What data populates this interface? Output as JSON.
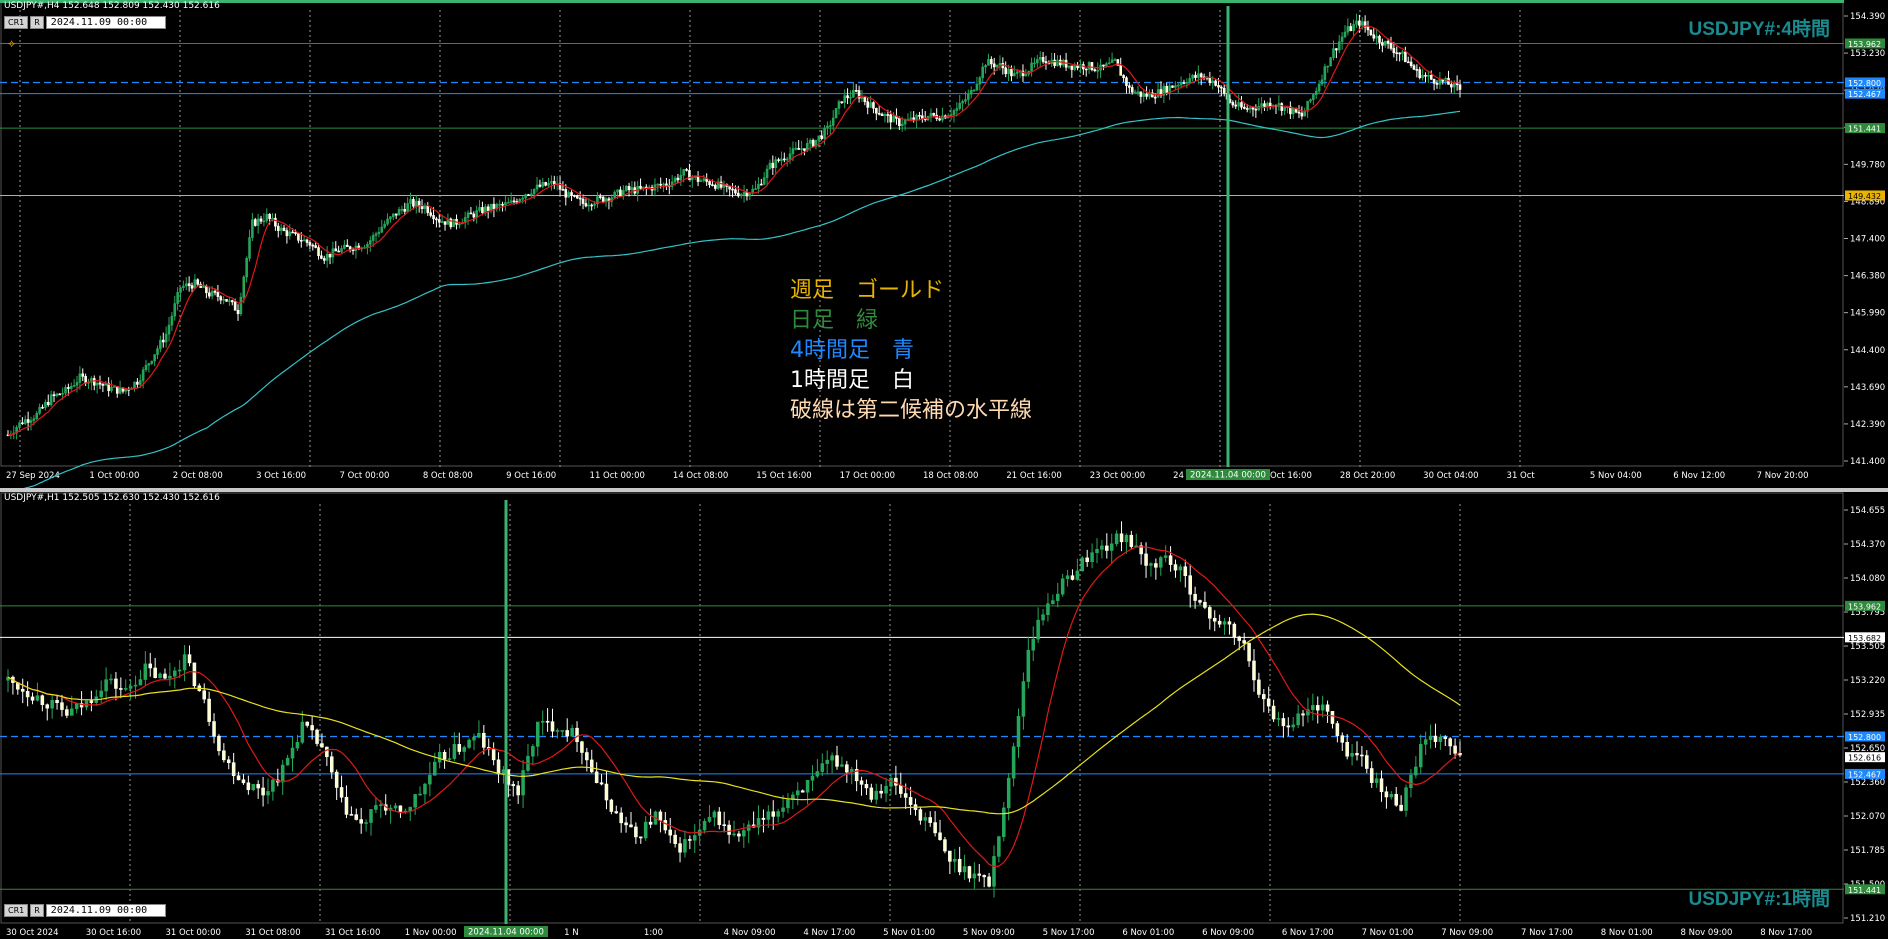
{
  "colors": {
    "background": "#000000",
    "bull": "#26a65b",
    "bear": "#ffffff",
    "bear_fill": "#ffffcc",
    "ma_red": "#e01818",
    "ma_cyan": "#33c3c8",
    "ma_yellow": "#e8e020",
    "gold": "#e8b400",
    "daily_green": "#2e8b3c",
    "h4_blue": "#1e88ff",
    "h1_white": "#ffffff",
    "grid": "#9a9a9a",
    "watermark": "#1a8a8e"
  },
  "controls": {
    "cr_label": "CR1",
    "r_label": "R",
    "datetime": "2024.11.09 00:00"
  },
  "legend": {
    "weekly": "週足　ゴールド",
    "daily": "日足　緑",
    "h4": "4時間足　青",
    "h1": "1時間足　白",
    "dashed": "破線は第二候補の水平線"
  },
  "chart_data": [
    {
      "type": "candlestick",
      "symbol_header": "USDJPY#,H4  152.648 152.809 152.430 152.616",
      "watermark": "USDJPY#:4時間",
      "y_ticks": [
        "154.390",
        "153.230",
        "152.070",
        "150.400",
        "149.780",
        "148.890",
        "147.400",
        "146.380",
        "145.990",
        "144.400",
        "143.690",
        "142.390",
        "141.400"
      ],
      "ylim": [
        141.4,
        154.9
      ],
      "x_ticks": [
        "27 Sep 2024",
        "1 Oct 00:00",
        "2 Oct 08:00",
        "3 Oct 16:00",
        "7 Oct 00:00",
        "8 Oct 08:00",
        "9 Oct 16:00",
        "11 Oct 00:00",
        "14 Oct 08:00",
        "15 Oct 16:00",
        "17 Oct 00:00",
        "18 Oct 08:00",
        "21 Oct 16:00",
        "23 Oct 00:00",
        "24 Oct 08:00",
        "25 Oct 16:00",
        "28 Oct 20:00",
        "30 Oct 04:00",
        "31 Oct",
        "5 Nov 04:00",
        "6 Nov 12:00",
        "7 Nov 20:00"
      ],
      "cursor_label": "2024.11.04 00:00",
      "levels": [
        {
          "price": 153.962,
          "label": "153.962",
          "style": "solid",
          "color": "#2e8b3c"
        },
        {
          "price": 152.8,
          "label": "152.800",
          "style": "dashed",
          "color": "#1e88ff"
        },
        {
          "price": 152.467,
          "label": "152.467",
          "style": "solid",
          "color": "#1e88ff"
        },
        {
          "price": 151.441,
          "label": "151.441",
          "style": "solid",
          "color": "#2e8b3c"
        },
        {
          "price": 149.432,
          "label": "149.432",
          "style": "solid",
          "color": "#e8b400"
        }
      ],
      "close_path": [
        142.3,
        142.7,
        142.9,
        143.4,
        143.6,
        144.0,
        143.9,
        143.7,
        143.6,
        143.9,
        144.6,
        145.3,
        146.7,
        146.8,
        146.5,
        146.4,
        146.0,
        148.6,
        148.8,
        148.4,
        148.2,
        148.0,
        147.6,
        147.8,
        147.9,
        148.0,
        148.5,
        148.9,
        149.2,
        149.1,
        148.7,
        148.6,
        148.8,
        149.0,
        149.1,
        149.2,
        149.5,
        149.7,
        149.8,
        149.4,
        149.2,
        149.3,
        149.4,
        149.6,
        149.6,
        149.7,
        149.8,
        150.1,
        149.9,
        149.8,
        149.6,
        149.5,
        149.6,
        150.3,
        150.6,
        150.8,
        151.0,
        151.4,
        152.3,
        152.5,
        152.1,
        151.8,
        151.6,
        151.7,
        151.8,
        151.8,
        152.0,
        152.5,
        153.4,
        153.3,
        153.0,
        153.2,
        153.5,
        153.4,
        153.3,
        153.3,
        153.2,
        153.4,
        152.6,
        152.4,
        152.5,
        152.7,
        152.9,
        153.0,
        152.8,
        152.2,
        152.0,
        152.1,
        152.2,
        152.0,
        151.8,
        152.6,
        153.6,
        154.3,
        154.6,
        154.2,
        153.9,
        153.6,
        153.1,
        152.9,
        152.8,
        152.6
      ],
      "ma_fast_color": "#e01818",
      "ma_slow_color": "#33c3c8"
    },
    {
      "type": "candlestick",
      "symbol_header": "USDJPY#,H1  152.505 152.630 152.430 152.616",
      "watermark": "USDJPY#:1時間",
      "y_ticks": [
        "154.655",
        "154.370",
        "154.080",
        "153.795",
        "153.505",
        "153.220",
        "152.935",
        "152.650",
        "152.360",
        "152.070",
        "151.785",
        "151.500",
        "151.210"
      ],
      "ylim": [
        151.15,
        154.85
      ],
      "x_ticks": [
        "30 Oct 2024",
        "30 Oct 16:00",
        "31 Oct 00:00",
        "31 Oct 08:00",
        "31 Oct 16:00",
        "1 Nov 00:00",
        "1 Nov 08:00",
        "1 N",
        "1:00",
        "4 Nov 09:00",
        "4 Nov 17:00",
        "5 Nov 01:00",
        "5 Nov 09:00",
        "5 Nov 17:00",
        "6 Nov 01:00",
        "6 Nov 09:00",
        "6 Nov 17:00",
        "7 Nov 01:00",
        "7 Nov 09:00",
        "7 Nov 17:00",
        "8 Nov 01:00",
        "8 Nov 09:00",
        "8 Nov 17:00"
      ],
      "cursor_label": "2024.11.04 00:00",
      "levels": [
        {
          "price": 153.962,
          "label": "153.962",
          "style": "solid",
          "color": "#2e8b3c"
        },
        {
          "price": 153.682,
          "label": "153.682",
          "style": "solid",
          "color": "#ffffff"
        },
        {
          "price": 152.8,
          "label": "152.800",
          "style": "dashed",
          "color": "#1e88ff"
        },
        {
          "price": 152.467,
          "label": "152.467",
          "style": "solid",
          "color": "#1e88ff"
        },
        {
          "price": 151.441,
          "label": "151.441",
          "style": "solid",
          "color": "#2e8b3c"
        }
      ],
      "last_price_label": "152.616",
      "close_path": [
        153.3,
        153.2,
        153.1,
        153.0,
        153.1,
        153.3,
        153.2,
        153.4,
        153.3,
        153.5,
        153.1,
        152.6,
        152.4,
        152.3,
        152.5,
        152.9,
        152.7,
        152.2,
        152.0,
        152.2,
        152.1,
        152.3,
        152.6,
        152.7,
        152.8,
        152.5,
        152.3,
        152.9,
        152.9,
        152.8,
        152.4,
        152.1,
        151.9,
        152.1,
        151.8,
        151.9,
        152.1,
        151.9,
        152.0,
        152.1,
        152.3,
        152.4,
        152.6,
        152.5,
        152.3,
        152.4,
        152.2,
        152.0,
        151.7,
        151.6,
        151.5,
        152.4,
        153.6,
        154.0,
        154.2,
        154.4,
        154.5,
        154.6,
        154.3,
        154.4,
        154.2,
        153.9,
        153.8,
        153.6,
        153.1,
        152.9,
        153.0,
        153.1,
        152.7,
        152.6,
        152.3,
        152.2,
        152.7,
        152.8,
        152.6
      ],
      "ma_fast_color": "#e01818",
      "ma_slow_color": "#e8e020"
    }
  ]
}
